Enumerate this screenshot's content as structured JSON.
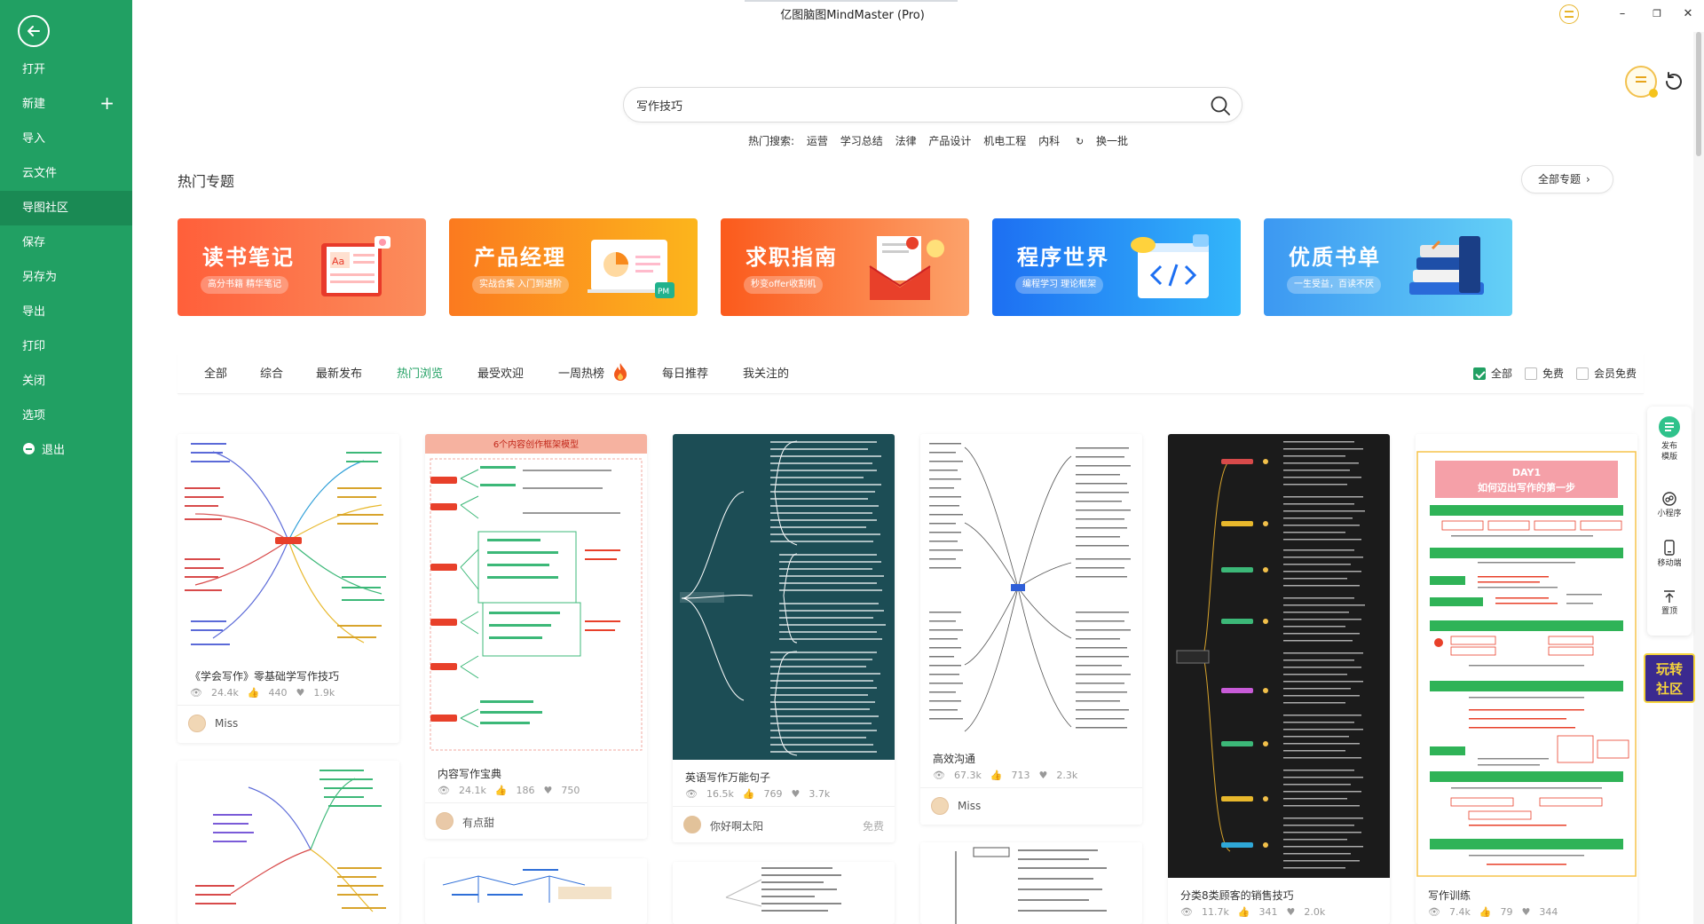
{
  "window": {
    "title": "亿图脑图MindMaster (Pro)",
    "minimize": "–",
    "restore": "❐",
    "close": "✕"
  },
  "sidebar": {
    "back_icon": "back-arrow-icon",
    "items": [
      {
        "label": "打开"
      },
      {
        "label": "新建",
        "extra": "+"
      },
      {
        "label": "导入"
      },
      {
        "label": "云文件"
      },
      {
        "label": "导图社区",
        "active": true
      },
      {
        "label": "保存"
      },
      {
        "label": "另存为"
      },
      {
        "label": "导出"
      },
      {
        "label": "打印"
      },
      {
        "label": "关闭"
      },
      {
        "label": "选项"
      },
      {
        "label": "退出"
      }
    ]
  },
  "search": {
    "value": "写作技巧",
    "hot_label": "热门搜索:",
    "hot_terms": [
      "运营",
      "学习总结",
      "法律",
      "产品设计",
      "机电工程",
      "内科"
    ],
    "refresh_label": "换一批"
  },
  "topics": {
    "title": "热门专题",
    "all_label": "全部专题",
    "banners": [
      {
        "title": "读书笔记",
        "subtitle": "高分书籍 精华笔记",
        "color_from": "#ff5f3a",
        "color_to": "#fb8d5c"
      },
      {
        "title": "产品经理",
        "subtitle": "实战合集 入门到进阶",
        "color_from": "#fb7a1f",
        "color_to": "#fcb51c"
      },
      {
        "title": "求职指南",
        "subtitle": "秒变offer收割机",
        "color_from": "#fb5a1c",
        "color_to": "#fca26a"
      },
      {
        "title": "程序世界",
        "subtitle": "编程学习 理论框架",
        "color_from": "#1d6ff2",
        "color_to": "#33b6fa"
      },
      {
        "title": "优质书单",
        "subtitle": "一生受益，百读不厌",
        "color_from": "#3c98f2",
        "color_to": "#64d0f6"
      }
    ]
  },
  "filters": {
    "tabs": [
      "全部",
      "综合",
      "最新发布",
      "热门浏览",
      "最受欢迎",
      "一周热榜",
      "每日推荐",
      "我关注的"
    ],
    "active_tab": "热门浏览",
    "checks": [
      {
        "label": "全部",
        "checked": true
      },
      {
        "label": "免费",
        "checked": false
      },
      {
        "label": "会员免费",
        "checked": false
      }
    ]
  },
  "float_bar": {
    "items": [
      {
        "label": "发布\n模版",
        "icon": "publish-icon"
      },
      {
        "label": "小程序",
        "icon": "mini-program-icon"
      },
      {
        "label": "移动端",
        "icon": "mobile-icon"
      },
      {
        "label": "置顶",
        "icon": "to-top-icon"
      }
    ],
    "community_badge": "玩转\n社区"
  },
  "cards": [
    {
      "title": "《学会写作》零基础学写作技巧",
      "views": "24.4k",
      "likes": "440",
      "favs": "1.9k",
      "author": "Miss",
      "free": ""
    },
    {
      "title": "内容写作宝典",
      "views": "24.1k",
      "likes": "186",
      "favs": "750",
      "author": "有点甜",
      "free": "",
      "thumb_title": "6个内容创作框架模型"
    },
    {
      "title": "英语写作万能句子",
      "views": "16.5k",
      "likes": "769",
      "favs": "3.7k",
      "author": "你好啊太阳",
      "free": "免费"
    },
    {
      "title": "高效沟通",
      "views": "67.3k",
      "likes": "713",
      "favs": "2.3k",
      "author": "Miss",
      "free": ""
    },
    {
      "title": "分类8类顾客的销售技巧",
      "views": "11.7k",
      "likes": "341",
      "favs": "2.0k",
      "author": "",
      "free": ""
    },
    {
      "title": "写作训练",
      "views": "7.4k",
      "likes": "79",
      "favs": "344",
      "author": "",
      "free": "",
      "thumb_title": "DAY1\n如何迈出写作的第一步"
    }
  ]
}
